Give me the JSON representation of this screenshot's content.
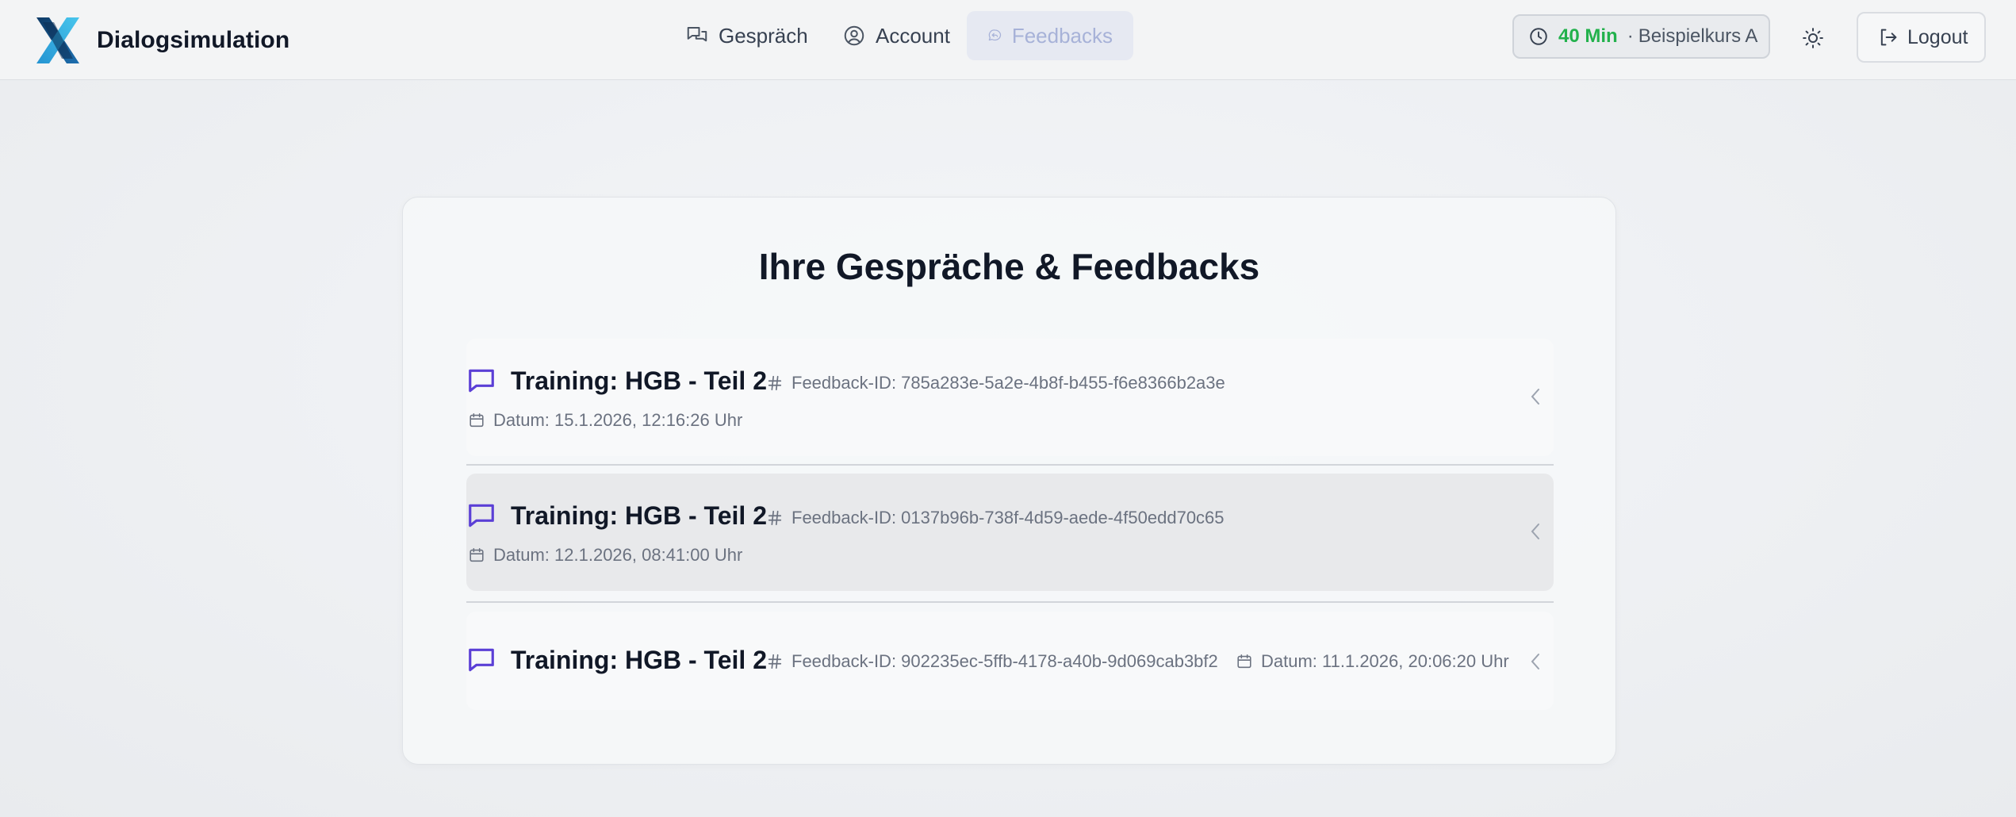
{
  "app": {
    "name": "Dialogsimulation",
    "logo_icon": "x-logo-icon"
  },
  "nav": {
    "items": [
      {
        "label": "Gespräch",
        "icon": "chat-bubbles-icon",
        "active": false
      },
      {
        "label": "Account",
        "icon": "user-circle-icon",
        "active": false
      },
      {
        "label": "Feedbacks",
        "icon": "feedback-icon",
        "active": true
      }
    ]
  },
  "header": {
    "timer_value": "40 Min",
    "timer_separator": "·",
    "course": "Beispielkurs A",
    "theme_icon": "sun-icon",
    "logout_label": "Logout"
  },
  "main": {
    "title": "Ihre Gespräche & Feedbacks",
    "feedbacks": [
      {
        "title": "Training: HGB - Teil 2",
        "feedback_id": "Feedback-ID: 785a283e-5a2e-4b8f-b455-f6e8366b2a3e",
        "date": "Datum: 15.1.2026, 12:16:26 Uhr"
      },
      {
        "title": "Training: HGB - Teil 2",
        "feedback_id": "Feedback-ID: 0137b96b-738f-4d59-aede-4f50edd70c65",
        "date": "Datum: 12.1.2026, 08:41:00 Uhr"
      },
      {
        "title": "Training: HGB - Teil 2",
        "feedback_id": "Feedback-ID: 902235ec-5ffb-4178-a40b-9d069cab3bf2",
        "date": "Datum: 11.1.2026, 20:06:20 Uhr"
      }
    ]
  },
  "colors": {
    "accent_purple": "#5b3fd6",
    "timer_green": "#22b14c",
    "active_nav_text": "#a7b2d8"
  }
}
